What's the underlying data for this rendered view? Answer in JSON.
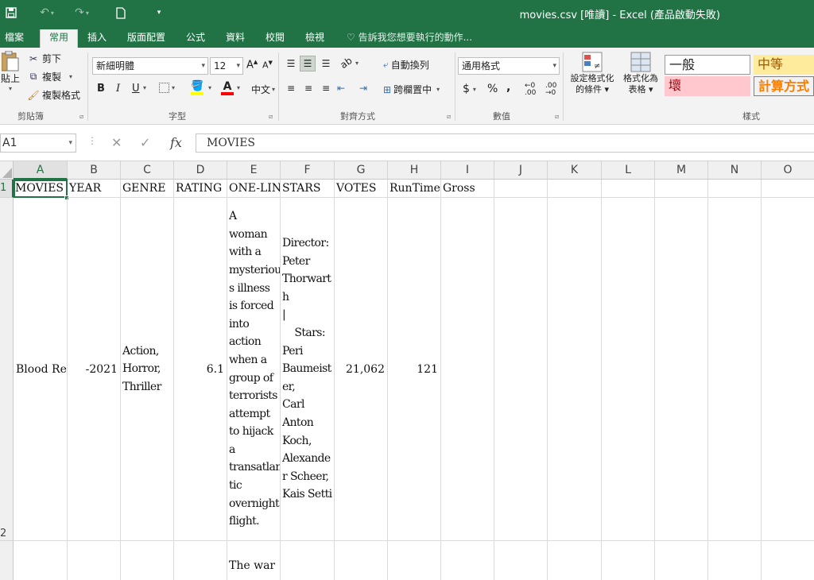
{
  "titlebar": {
    "title": "movies.csv  [唯讀] - Excel (產品啟動失敗)",
    "save_icon": "save-icon",
    "undo_icon": "undo-icon",
    "redo_icon": "redo-icon",
    "new_icon": "new-document-icon"
  },
  "tabs": {
    "file": "檔案",
    "home": "常用",
    "insert": "插入",
    "page_layout": "版面配置",
    "formulas": "公式",
    "data": "資料",
    "review": "校閱",
    "view": "檢視",
    "tell_me": "告訴我您想要執行的動作..."
  },
  "ribbon": {
    "clipboard": {
      "paste": "貼上",
      "cut": "剪下",
      "copy": "複製",
      "format_painter": "複製格式",
      "label": "剪貼簿"
    },
    "font": {
      "name": "新細明體",
      "size": "12",
      "bold": "B",
      "italic": "I",
      "underline": "U",
      "font_color": "A",
      "label": "字型"
    },
    "alignment": {
      "wrap_text": "自動換列",
      "merge_center": "跨欄置中",
      "label": "對齊方式"
    },
    "number": {
      "format": "通用格式",
      "currency": "$",
      "percent": "%",
      "comma": ",",
      "label": "數值"
    },
    "styles": {
      "conditional": "設定格式化的條件",
      "conditional_line1": "設定格式化",
      "conditional_line2": "的條件",
      "format_table_line1": "格式化為",
      "format_table_line2": "表格",
      "normal": "一般",
      "neutral": "中等",
      "bad": "壞",
      "calculation": "計算方式",
      "label": "樣式"
    }
  },
  "formula_bar": {
    "name_box": "A1",
    "formula": "MOVIES"
  },
  "columns": [
    "A",
    "B",
    "C",
    "D",
    "E",
    "F",
    "G",
    "H",
    "I",
    "J",
    "K",
    "L",
    "M",
    "N",
    "O"
  ],
  "rows": [
    "1",
    "2"
  ],
  "header_row": [
    "MOVIES",
    "YEAR",
    "GENRE",
    "RATING",
    "ONE-LINE",
    "STARS",
    "VOTES",
    "RunTime",
    "Gross"
  ],
  "data_row": {
    "movie": "Blood Red Sky",
    "year": "-2021",
    "genre": "Action,\nHorror,\nThriller",
    "rating": "6.1",
    "one_line": "A\nwoman\nwith a\nmysteriou\ns illness\nis forced\ninto\naction\nwhen a\ngroup of\nterrorists\nattempt\nto hijack\na\ntransatlan\ntic\novernight\nflight.",
    "stars": "Director:\nPeter\nThorwart\nh\n|\n    Stars:\nPeri\nBaumeist\ner,\nCarl\nAnton\nKoch,\nAlexande\nr Scheer,\nKais Setti",
    "votes": "21,062",
    "runtime": "121",
    "gross": ""
  },
  "row3_partial": "The war"
}
